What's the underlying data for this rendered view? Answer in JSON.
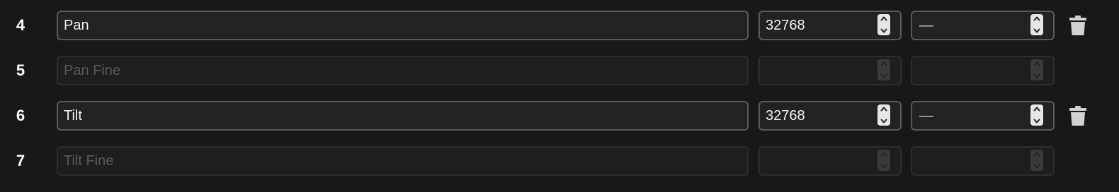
{
  "rows": [
    {
      "number": "4",
      "name": "Pan",
      "name_placeholder": "",
      "value": "32768",
      "alt_value": "—",
      "active": true,
      "delete_icon": "trash-icon"
    },
    {
      "number": "5",
      "name": "",
      "name_placeholder": "Pan Fine",
      "value": "",
      "alt_value": "",
      "active": false
    },
    {
      "number": "6",
      "name": "Tilt",
      "name_placeholder": "",
      "value": "32768",
      "alt_value": "—",
      "active": true,
      "delete_icon": "trash-icon"
    },
    {
      "number": "7",
      "name": "",
      "name_placeholder": "Tilt Fine",
      "value": "",
      "alt_value": "",
      "active": false
    }
  ],
  "colors": {
    "background": "#181818",
    "field_border_active": "#5a5a5a",
    "field_border_inactive": "#2e2e2e",
    "text": "#f2f2f2",
    "placeholder": "#5a5a5a"
  }
}
